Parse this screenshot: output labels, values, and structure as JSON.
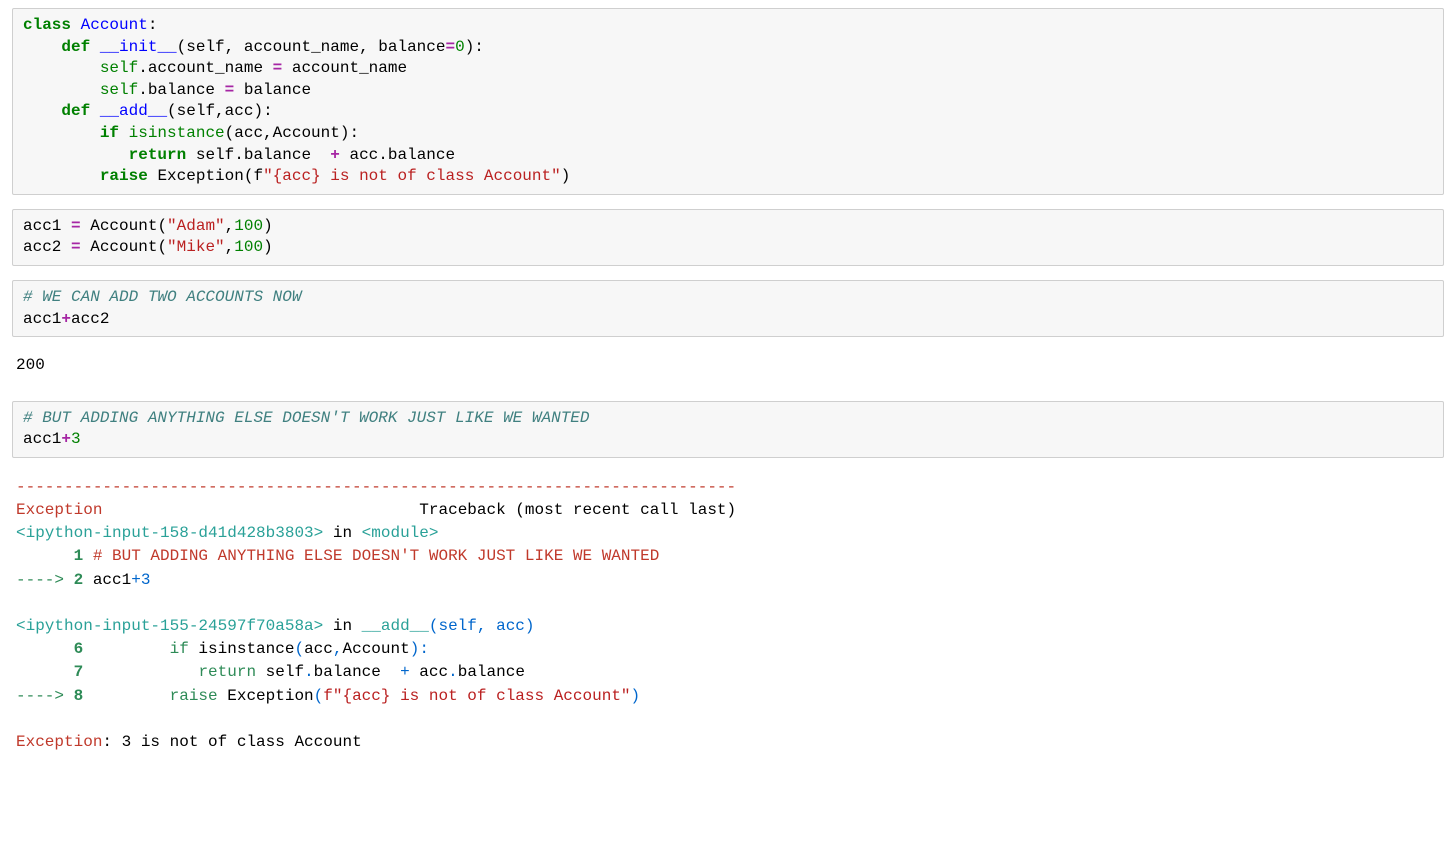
{
  "cells": {
    "c1": {
      "l1_kw1": "class",
      "l1_cls": "Account",
      "l1_colon": ":",
      "l2_pad": "    ",
      "l2_kw": "def",
      "l2_sp": " ",
      "l2_fn": "__init__",
      "l2_rest": "(self, account_name, balance",
      "l2_eq": "=",
      "l2_zero": "0",
      "l2_end": "):",
      "l3_pad": "        ",
      "l3_self": "self",
      "l3_dot": ".account_name ",
      "l3_eq": "=",
      "l3_rest": " account_name",
      "l4_pad": "        ",
      "l4_self": "self",
      "l4_dot": ".balance ",
      "l4_eq": "=",
      "l4_rest": " balance",
      "l5_pad": "    ",
      "l5_kw": "def",
      "l5_sp": " ",
      "l5_fn": "__add__",
      "l5_rest": "(self,acc):",
      "l6_pad": "        ",
      "l6_kw": "if",
      "l6_sp": " ",
      "l6_bi": "isinstance",
      "l6_rest": "(acc,Account):",
      "l7_pad": "           ",
      "l7_kw": "return",
      "l7_rest": " self.balance  ",
      "l7_plus": "+",
      "l7_rest2": " acc.balance",
      "l8_pad": "        ",
      "l8_kw": "raise",
      "l8_sp": " ",
      "l8_exc": "Exception(f",
      "l8_str": "\"{acc} is not of class Account\"",
      "l8_end": ")"
    },
    "c2": {
      "l1_a": "acc1 ",
      "l1_eq": "=",
      "l1_b": " Account(",
      "l1_str": "\"Adam\"",
      "l1_c": ",",
      "l1_num": "100",
      "l1_d": ")",
      "l2_a": "acc2 ",
      "l2_eq": "=",
      "l2_b": " Account(",
      "l2_str": "\"Mike\"",
      "l2_c": ",",
      "l2_num": "100",
      "l2_d": ")"
    },
    "c3": {
      "l1": "# WE CAN ADD TWO ACCOUNTS NOW",
      "l2_a": "acc1",
      "l2_plus": "+",
      "l2_b": "acc2"
    },
    "out3": "200",
    "c4": {
      "l1": "# BUT ADDING ANYTHING ELSE DOESN'T WORK JUST LIKE WE WANTED",
      "l2_a": "acc1",
      "l2_plus": "+",
      "l2_num": "3"
    },
    "err": {
      "sep": "---------------------------------------------------------------------------",
      "name": "Exception",
      "tb_spacer": "                                 ",
      "tb_label": "Traceback (most recent call last)",
      "loc1a": "<ipython-input-158-d41d428b3803>",
      "loc1b": " in ",
      "loc1c": "<module>",
      "f1n": "      1 ",
      "f1t": "# BUT ADDING ANYTHING ELSE DOESN'T WORK JUST LIKE WE WANTED",
      "f2arrow": "----> ",
      "f2n": "2 ",
      "f2a": "acc1",
      "f2plus": "+",
      "f2num": "3",
      "loc2a": "<ipython-input-155-24597f70a58a>",
      "loc2b": " in ",
      "loc2c": "__add__",
      "loc2d": "(self, acc)",
      "g1n": "      6 ",
      "g1pad": "        ",
      "g1a": "if",
      "g1b": " isinstance",
      "g1c": "(",
      "g1d": "acc",
      "g1e": ",",
      "g1f": "Account",
      "g1g": ")",
      "g1h": ":",
      "g2n": "      7 ",
      "g2pad": "           ",
      "g2a": "return",
      "g2b": " self",
      "g2c": ".",
      "g2d": "balance  ",
      "g2e": "+",
      "g2f": " acc",
      "g2g": ".",
      "g2h": "balance",
      "g3arrow": "----> ",
      "g3n": "8 ",
      "g3pad": "        ",
      "g3a": "raise",
      "g3b": " Exception",
      "g3c": "(",
      "g3d": "f\"{acc} is not of class Account\"",
      "g3e": ")",
      "finalname": "Exception",
      "finalmsg": ": 3 is not of class Account"
    }
  }
}
